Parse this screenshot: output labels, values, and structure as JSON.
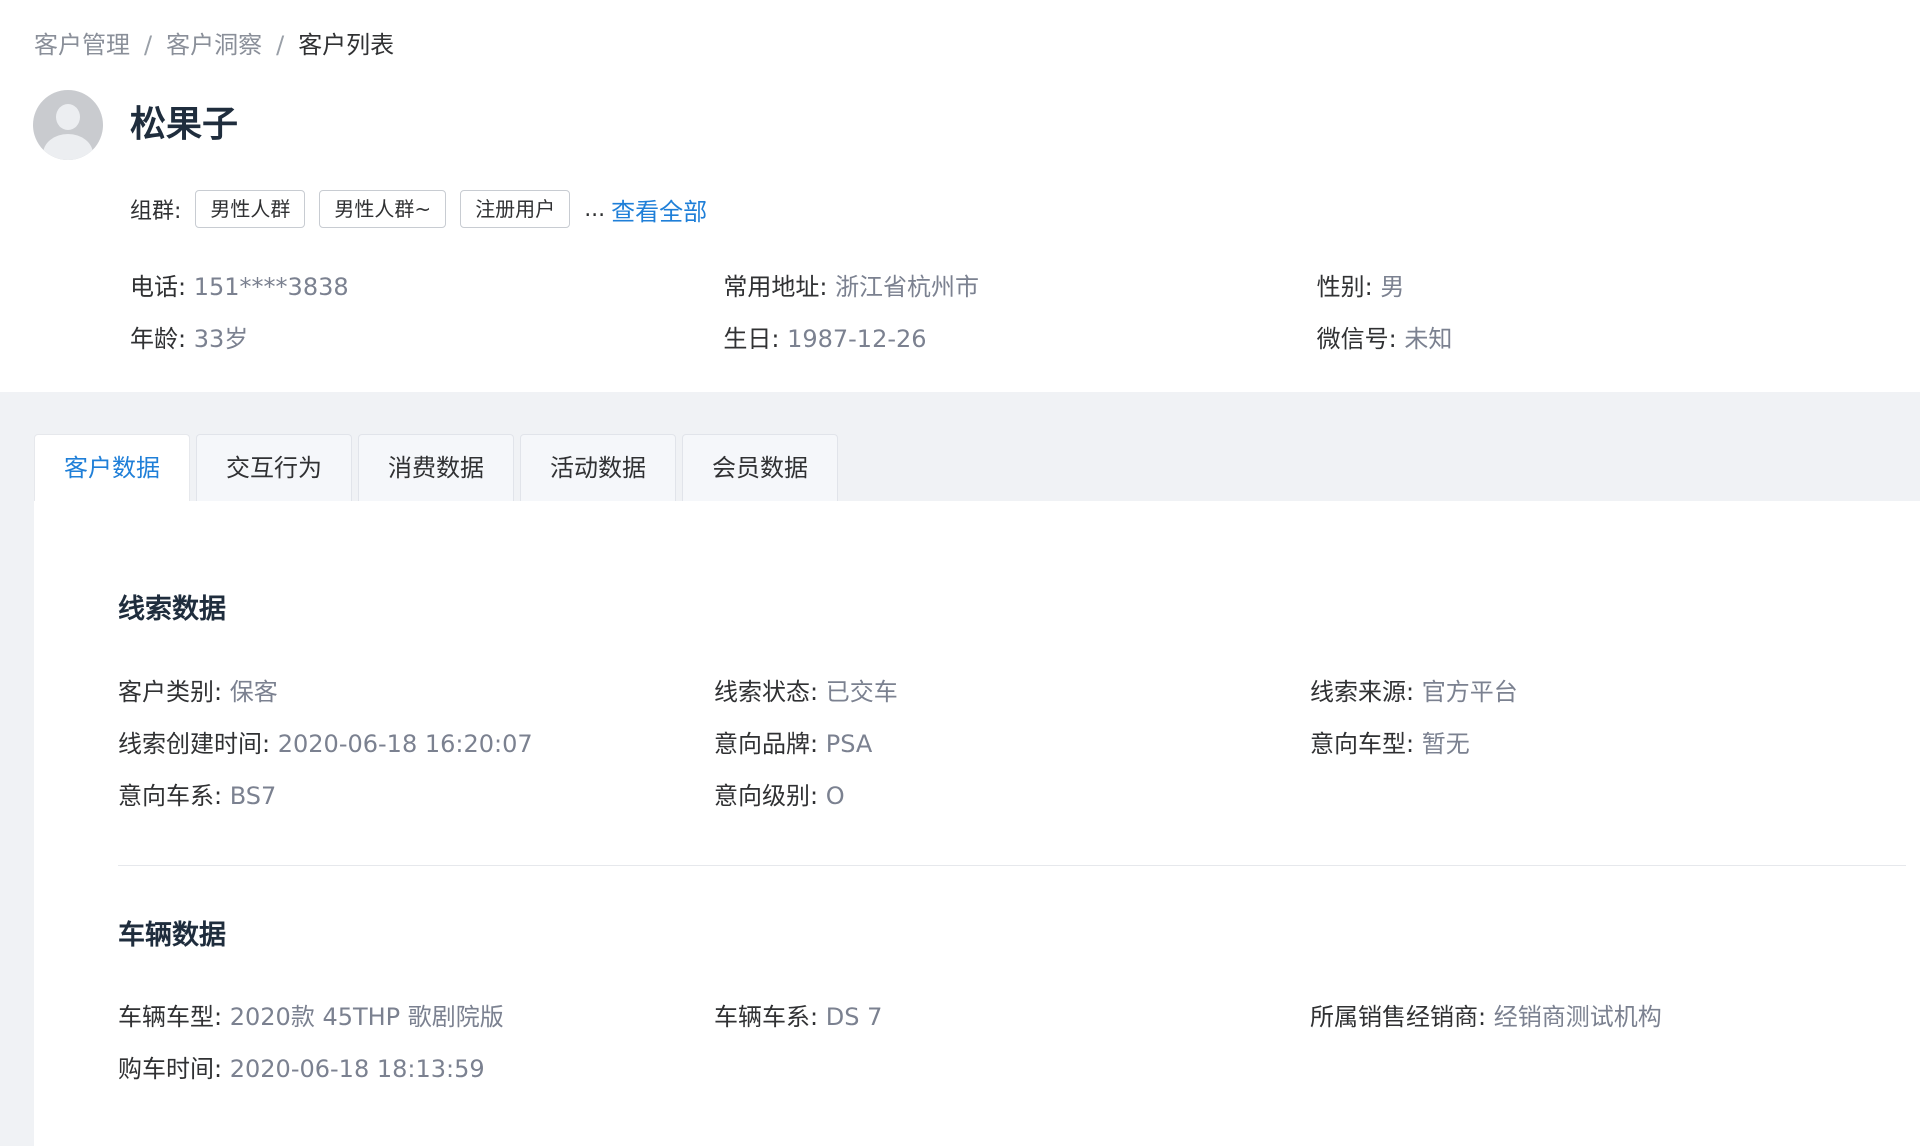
{
  "breadcrumb": {
    "items": [
      "客户管理",
      "客户洞察",
      "客户列表"
    ],
    "separator": "/"
  },
  "profile": {
    "name": "松果子",
    "group_label": "组群:",
    "groups": [
      "男性人群",
      "男性人群~",
      "注册用户"
    ],
    "ellipsis": "...",
    "view_all": "查看全部",
    "info": {
      "phone": {
        "label": "电话:",
        "value": "151****3838"
      },
      "address": {
        "label": "常用地址:",
        "value": "浙江省杭州市"
      },
      "gender": {
        "label": "性别:",
        "value": "男"
      },
      "age": {
        "label": "年龄:",
        "value": "33岁"
      },
      "birthday": {
        "label": "生日:",
        "value": "1987-12-26"
      },
      "wechat": {
        "label": "微信号:",
        "value": "未知"
      }
    }
  },
  "tabs": [
    {
      "label": "客户数据",
      "active": true
    },
    {
      "label": "交互行为",
      "active": false
    },
    {
      "label": "消费数据",
      "active": false
    },
    {
      "label": "活动数据",
      "active": false
    },
    {
      "label": "会员数据",
      "active": false
    }
  ],
  "lead_section": {
    "title": "线索数据",
    "fields": {
      "customer_type": {
        "label": "客户类别:",
        "value": "保客"
      },
      "lead_status": {
        "label": "线索状态:",
        "value": "已交车"
      },
      "lead_source": {
        "label": "线索来源:",
        "value": "官方平台"
      },
      "created_time": {
        "label": "线索创建时间:",
        "value": "2020-06-18 16:20:07"
      },
      "intent_brand": {
        "label": "意向品牌:",
        "value": "PSA"
      },
      "intent_model": {
        "label": "意向车型:",
        "value": "暂无"
      },
      "intent_series": {
        "label": "意向车系:",
        "value": "BS7"
      },
      "intent_level": {
        "label": "意向级别:",
        "value": "O"
      }
    }
  },
  "vehicle_section": {
    "title": "车辆数据",
    "fields": {
      "vehicle_model": {
        "label": "车辆车型:",
        "value": "2020款 45THP 歌剧院版"
      },
      "vehicle_series": {
        "label": "车辆车系:",
        "value": "DS 7"
      },
      "dealer": {
        "label": "所属销售经销商:",
        "value": "经销商测试机构"
      },
      "purchase_time": {
        "label": "购车时间:",
        "value": "2020-06-18 18:13:59"
      }
    }
  },
  "colors": {
    "accent": "#1f7fd8",
    "label_text": "#303133",
    "value_text": "#7b8190",
    "page_background": "#f0f2f5"
  }
}
